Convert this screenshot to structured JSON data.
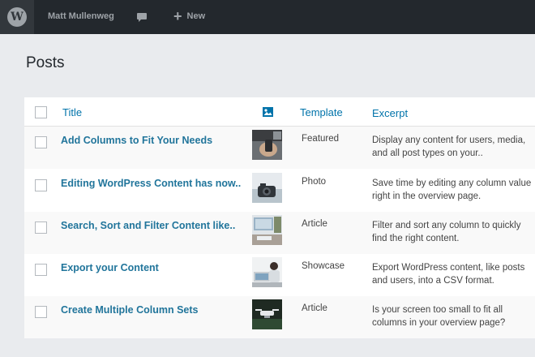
{
  "adminbar": {
    "user": "Matt Mullenweg",
    "new_label": "New",
    "logo_glyph": "W",
    "colors": {
      "bar": "#23282d",
      "logo_bg": "#32373c",
      "text": "#9ea3a8"
    }
  },
  "page": {
    "title": "Posts"
  },
  "table": {
    "columns": {
      "title": "Title",
      "featured_image_icon": "image-icon",
      "template": "Template",
      "excerpt": "Excerpt"
    },
    "rows": [
      {
        "title": "Add Columns to Fit Your Needs",
        "template": "Featured",
        "excerpt": "Display any content for users, media, and all post types on your..",
        "thumb": "phone-photo"
      },
      {
        "title": "Editing WordPress Content has now..",
        "template": "Photo",
        "excerpt": "Save time by editing any column value right in the overview page.",
        "thumb": "camera-photo"
      },
      {
        "title": "Search, Sort and Filter Content like..",
        "template": "Article",
        "excerpt": "Filter and sort any column to quickly find the right content.",
        "thumb": "desk-photo"
      },
      {
        "title": "Export your Content",
        "template": "Showcase",
        "excerpt": "Export WordPress content, like posts and users, into a CSV format.",
        "thumb": "workspace-photo"
      },
      {
        "title": "Create Multiple Column Sets",
        "template": "Article",
        "excerpt": "Is your screen too small to fit all columns in your overview page?",
        "thumb": "drone-photo"
      }
    ]
  },
  "colors": {
    "link": "#21759b",
    "header_link": "#0073aa",
    "background": "#e9ebee"
  }
}
